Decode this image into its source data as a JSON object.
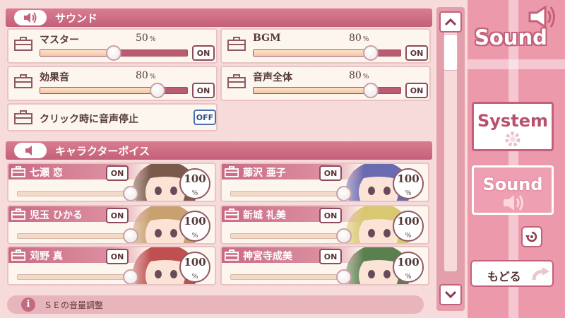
{
  "sound_section": {
    "title": "サウンド",
    "icon": "speaker-waves-icon",
    "unit": "%",
    "channels": [
      {
        "label": "マスター",
        "value": "50",
        "level": 0.5,
        "toggle": "ON"
      },
      {
        "label": "BGM",
        "value": "80",
        "level": 0.8,
        "toggle": "ON"
      },
      {
        "label": "効果音",
        "value": "80",
        "level": 0.8,
        "toggle": "ON"
      },
      {
        "label": "音声全体",
        "value": "80",
        "level": 0.8,
        "toggle": "ON"
      }
    ],
    "click_stop": {
      "label": "クリック時に音声停止",
      "toggle": "OFF"
    }
  },
  "voice_section": {
    "title": "キャラクターボイス",
    "icon": "speaker-icon",
    "unit": "%",
    "characters": [
      {
        "name": "七瀬 恋",
        "toggle": "ON",
        "value": "100",
        "level": 1.0,
        "hair": "#7a5a4a"
      },
      {
        "name": "藤沢 亜子",
        "toggle": "ON",
        "value": "100",
        "level": 1.0,
        "hair": "#6a6ab0"
      },
      {
        "name": "児玉 ひかる",
        "toggle": "ON",
        "value": "100",
        "level": 1.0,
        "hair": "#c9a070"
      },
      {
        "name": "新城 礼美",
        "toggle": "ON",
        "value": "100",
        "level": 1.0,
        "hair": "#d8c870"
      },
      {
        "name": "苅野 真",
        "toggle": "ON",
        "value": "100",
        "level": 1.0,
        "hair": "#c05050"
      },
      {
        "name": "神宮寺成美",
        "toggle": "ON",
        "value": "100",
        "level": 1.0,
        "hair": "#5a8050"
      }
    ]
  },
  "info": {
    "text": "ＳＥの音量調整",
    "icon": "info-icon"
  },
  "sidebar": {
    "logo": "Sound",
    "system_label": "System",
    "sound_label": "Sound",
    "back_label": "もどる"
  },
  "colors": {
    "accent": "#c4607a",
    "panel": "#fdf6ee",
    "background": "#f7dada"
  }
}
